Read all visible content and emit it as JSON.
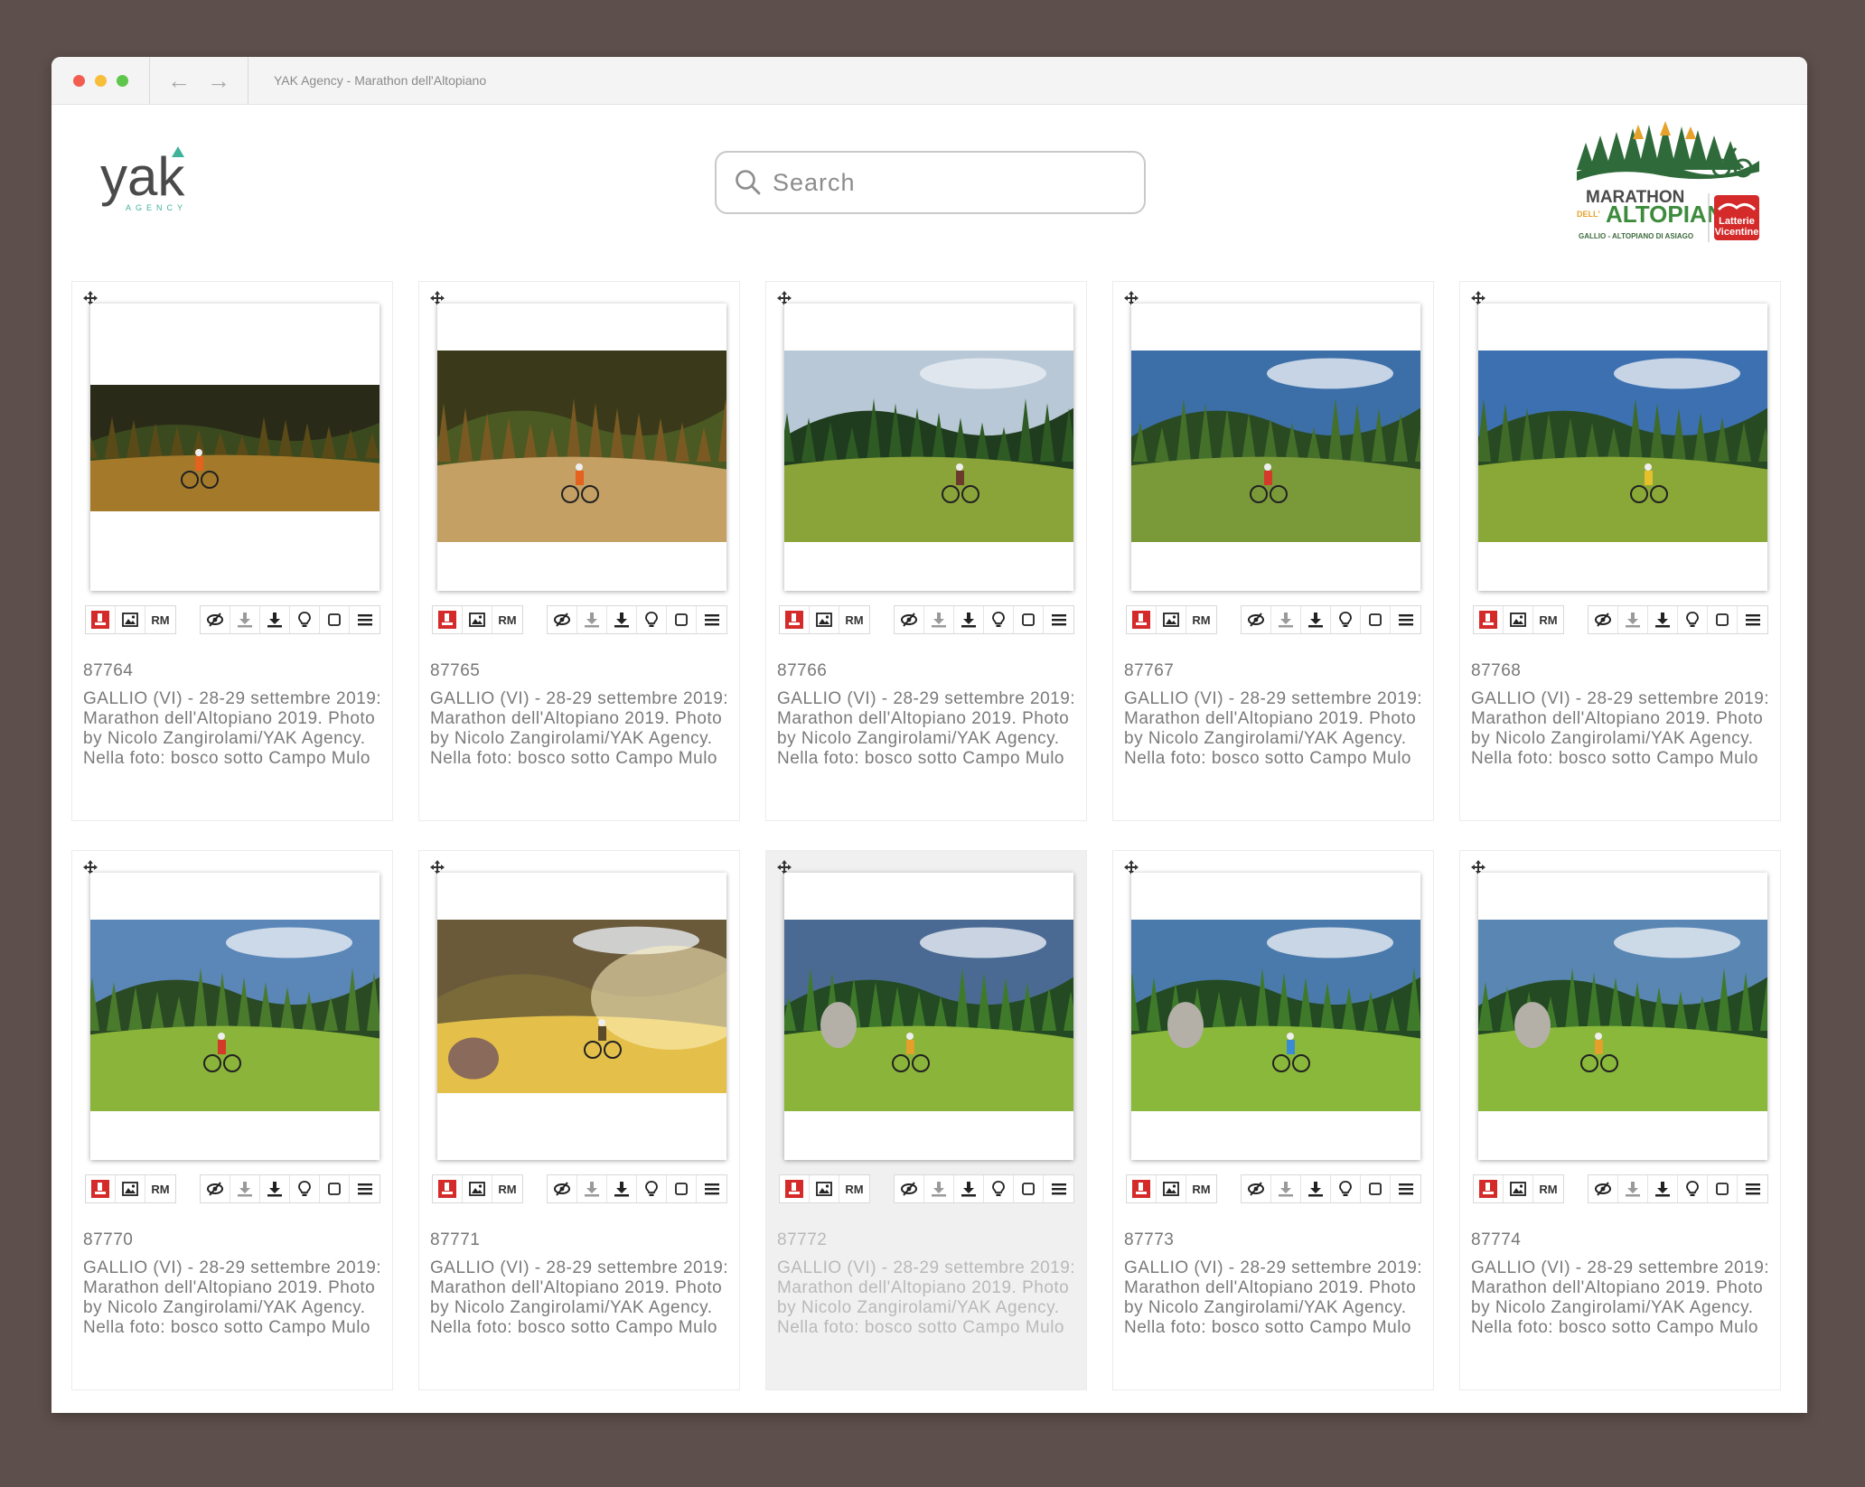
{
  "window": {
    "title": "YAK Agency - Marathon dell'Altopiano",
    "back_icon": "arrow-left-icon",
    "forward_icon": "arrow-right-icon"
  },
  "header": {
    "logo_text": "yak",
    "logo_sub": "AGENCY",
    "search_placeholder": "Search",
    "event_logo": {
      "line1": "MARATHON",
      "prefix": "DELL'",
      "line2": "ALTOPIANO",
      "location": "GALLIO - ALTOPIANO DI ASIAGO",
      "sponsor1": "Latterie",
      "sponsor2": "Vicentine"
    }
  },
  "toolbar": {
    "rm_label": "RM"
  },
  "colors": {
    "accent_red": "#d42a2a",
    "logo_teal": "#3fb39a",
    "logo_gray": "#4a4a4a"
  },
  "cards": [
    {
      "code": "87764",
      "caption": "GALLIO (VI) - 28-29 settembre 2019: Marathon dell'Altopiano 2019. Photo by Nicolo Zangirolami/YAK Agency. Nella foto: bosco sotto Campo Mulo"
    },
    {
      "code": "87765",
      "caption": "GALLIO (VI) - 28-29 settembre 2019: Marathon dell'Altopiano 2019. Photo by Nicolo Zangirolami/YAK Agency. Nella foto: bosco sotto Campo Mulo"
    },
    {
      "code": "87766",
      "caption": "GALLIO (VI) - 28-29 settembre 2019: Marathon dell'Altopiano 2019. Photo by Nicolo Zangirolami/YAK Agency. Nella foto: bosco sotto Campo Mulo"
    },
    {
      "code": "87767",
      "caption": "GALLIO (VI) - 28-29 settembre 2019: Marathon dell'Altopiano 2019. Photo by Nicolo Zangirolami/YAK Agency. Nella foto: bosco sotto Campo Mulo"
    },
    {
      "code": "87768",
      "caption": "GALLIO (VI) - 28-29 settembre 2019: Marathon dell'Altopiano 2019. Photo by Nicolo Zangirolami/YAK Agency. Nella foto: bosco sotto Campo Mulo"
    },
    {
      "code": "87770",
      "caption": "GALLIO (VI) - 28-29 settembre 2019: Marathon dell'Altopiano 2019. Photo by Nicolo Zangirolami/YAK Agency. Nella foto: bosco sotto Campo Mulo"
    },
    {
      "code": "87771",
      "caption": "GALLIO (VI) - 28-29 settembre 2019: Marathon dell'Altopiano 2019. Photo by Nicolo Zangirolami/YAK Agency. Nella foto: bosco sotto Campo Mulo"
    },
    {
      "code": "87772",
      "caption": "GALLIO (VI) - 28-29 settembre 2019: Marathon dell'Altopiano 2019. Photo by Nicolo Zangirolami/YAK Agency. Nella foto: bosco sotto Campo Mulo"
    },
    {
      "code": "87773",
      "caption": "GALLIO (VI) - 28-29 settembre 2019: Marathon dell'Altopiano 2019. Photo by Nicolo Zangirolami/YAK Agency. Nella foto: bosco sotto Campo Mulo"
    },
    {
      "code": "87774",
      "caption": "GALLIO (VI) - 28-29 settembre 2019: Marathon dell'Altopiano 2019. Photo by Nicolo Zangirolami/YAK Agency. Nella foto: bosco sotto Campo Mulo"
    }
  ]
}
